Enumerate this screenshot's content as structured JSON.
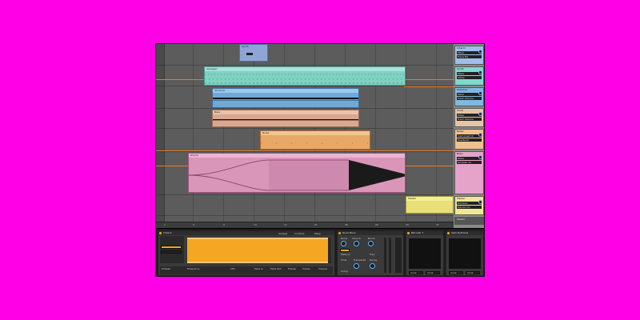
{
  "tracks": {
    "clip_names": {
      "arp": "Arpeggio",
      "synth": "Synth",
      "pad": "Shimmer",
      "pad2": "Shimmer",
      "bass": "Bass",
      "bass2": "Bass",
      "noise": "Noise",
      "drums": "Drums"
    }
  },
  "ruler": {
    "ticks": [
      "1",
      "5",
      "9",
      "13",
      "17",
      "21",
      "25",
      "29",
      "33",
      "37"
    ]
  },
  "mixer": {
    "tracks": [
      {
        "name": "Inharm",
        "row1": "Mixer",
        "row2": "Trace Mo",
        "color": "#9ec0e8"
      },
      {
        "name": "Synth",
        "row1": "Mixer",
        "row2": "Utility",
        "color": "#7fd9cf"
      },
      {
        "name": "Shimmer",
        "row1": "Mixer",
        "row2": "Track Volume",
        "color": "#7fb8e0"
      },
      {
        "name": "Vocal",
        "row1": "Mixer",
        "row2": "Track Volume",
        "color": "#e4c4a8"
      },
      {
        "name": "Noise",
        "row1": "Instrument R",
        "row2": "Feedback",
        "color": "#f0c08a"
      },
      {
        "name": "Bass",
        "row1": "Mixer",
        "row2": "Sampler 4x",
        "color": "#e6a3c9"
      },
      {
        "name": "Master",
        "row1": "Random",
        "row2": "Device On",
        "color": "#f0e890"
      }
    ]
  },
  "devices": {
    "clip_name": "Inharm",
    "sample_label": "Sample",
    "controls_label": "Controls",
    "warp_label": "Warp",
    "drum_buss_title": "Drum Buss",
    "drive_label": "Drive",
    "crunch_label": "Crunch",
    "boom_label": "Boom",
    "freq_label": "Freq",
    "decay_label": "Decay",
    "transients_label": "Transients",
    "comp_label": "Comp",
    "medium_label": "Medium",
    "time_label": "Time",
    "simpler_title": "Simpler",
    "filter_label": "Frequency",
    "lfo_label": "LFO",
    "voices_label": "Voices",
    "fade_in_label": "Fade In",
    "fade_out_label": "Fade Out",
    "transp_label": "Transp",
    "vol_label": "Volume",
    "bitcrush_title": "Bitcrush 7",
    "none1": "none",
    "none2": "none",
    "unison_title": "VelocityFollow",
    "none3": "none",
    "none4": "none"
  },
  "colors": {
    "arp": "#8fd6c8",
    "synth": "#9ec0e8",
    "pad": "#7fb8e0",
    "bass": "#e4b49a",
    "noise": "#f0b074",
    "drums": "#e6a3c9",
    "master": "#f1ea84",
    "waveform": "#f5a623"
  }
}
